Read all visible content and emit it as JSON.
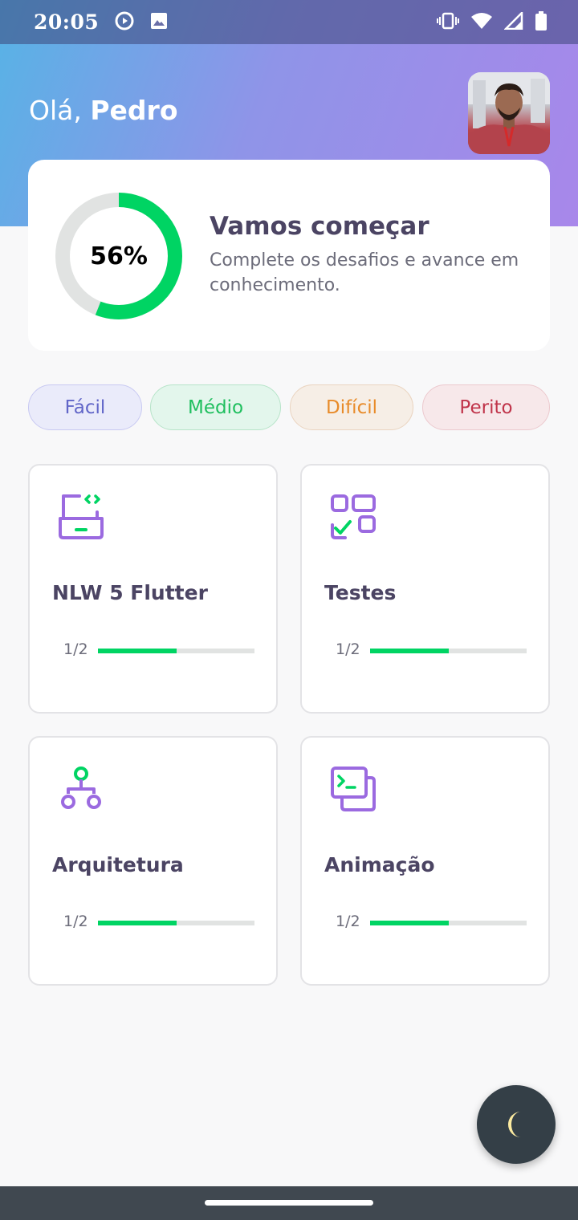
{
  "status_bar": {
    "time": "20:05"
  },
  "header": {
    "greeting": "Olá,",
    "user_name": "Pedro"
  },
  "score_card": {
    "percent": 56,
    "percent_label": "56%",
    "title": "Vamos começar",
    "subtitle": "Complete os desafios e avance em conhecimento.",
    "progress_color": "#00d463",
    "track_color": "#e1e3e2"
  },
  "levels": [
    {
      "label": "Fácil"
    },
    {
      "label": "Médio"
    },
    {
      "label": "Difícil"
    },
    {
      "label": "Perito"
    }
  ],
  "quizzes": [
    {
      "title": "NLW 5 Flutter",
      "progress_label": "1/2",
      "progress": 0.5,
      "icon": "laptop-code-icon"
    },
    {
      "title": "Testes",
      "progress_label": "1/2",
      "progress": 0.5,
      "icon": "checklist-grid-icon"
    },
    {
      "title": "Arquitetura",
      "progress_label": "1/2",
      "progress": 0.5,
      "icon": "hierarchy-icon"
    },
    {
      "title": "Animação",
      "progress_label": "1/2",
      "progress": 0.5,
      "icon": "terminal-window-icon"
    }
  ],
  "theme_toggle": {
    "icon": "moon-icon"
  },
  "colors": {
    "accent_purple": "#9b6ae0",
    "accent_green": "#00d463",
    "heading": "#4b4463"
  }
}
